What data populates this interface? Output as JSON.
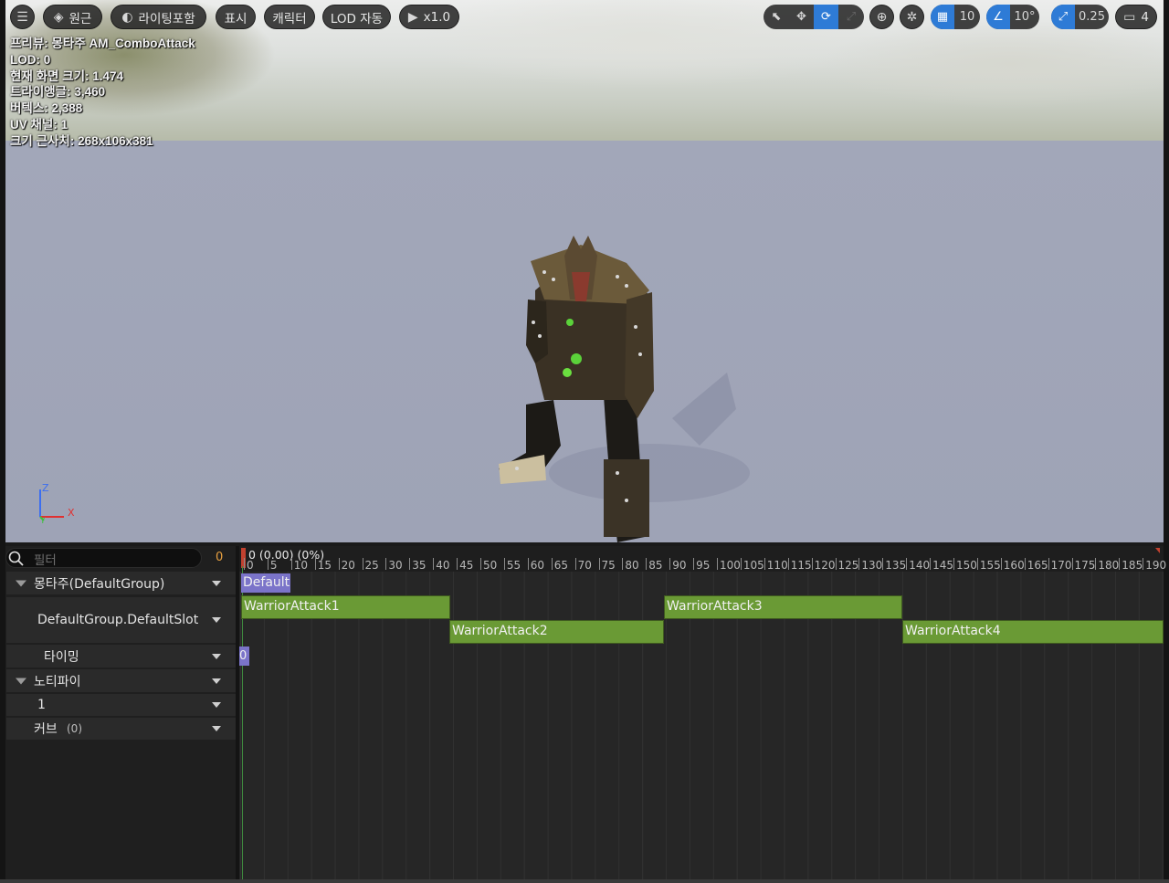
{
  "toolbar": {
    "menu_icon": "hamburger-icon",
    "perspective": "원근",
    "lighting": "라이팅포함",
    "show": "표시",
    "character": "캐릭터",
    "lod": "LOD 자동",
    "speed": "x1.0",
    "grid_value": "10",
    "angle_value": "10°",
    "scale_value": "0.25",
    "camera_speed": "4"
  },
  "stats": {
    "preview": "프리뷰: 몽타주 AM_ComboAttack",
    "lod": "LOD: 0",
    "screen_size": "현재 화면 크기: 1.474",
    "triangles": "트라이앵글: 3,460",
    "vertices": "버텍스: 2,388",
    "uv_channels": "UV 채널: 1",
    "bounds": "크기 근사치: 268x106x381"
  },
  "axes": {
    "x": "X",
    "y": "Y",
    "z": "Z"
  },
  "sequencer": {
    "filter_placeholder": "필터",
    "filter_count": "0",
    "time_readout": "0 (0.00) (0%)",
    "ticks": [
      "0",
      "5",
      "10",
      "15",
      "20",
      "25",
      "30",
      "35",
      "40",
      "45",
      "50",
      "55",
      "60",
      "65",
      "70",
      "75",
      "80",
      "85",
      "90",
      "95",
      "100",
      "105",
      "110",
      "115",
      "120",
      "125",
      "130",
      "135",
      "140",
      "145",
      "150",
      "155",
      "160",
      "165",
      "170",
      "175",
      "180",
      "185",
      "190"
    ],
    "tracks": {
      "montage": "몽타주(DefaultGroup)",
      "slot": "DefaultGroup.DefaultSlot",
      "timing": "타이밍",
      "notify": "노티파이",
      "notify_track": "1",
      "curves": "커브",
      "curves_count": "(0)"
    },
    "section_chip": "Default",
    "time_chip": "0",
    "segments": [
      {
        "name": "WarriorAttack1"
      },
      {
        "name": "WarriorAttack2"
      },
      {
        "name": "WarriorAttack3"
      },
      {
        "name": "WarriorAttack4"
      }
    ]
  }
}
